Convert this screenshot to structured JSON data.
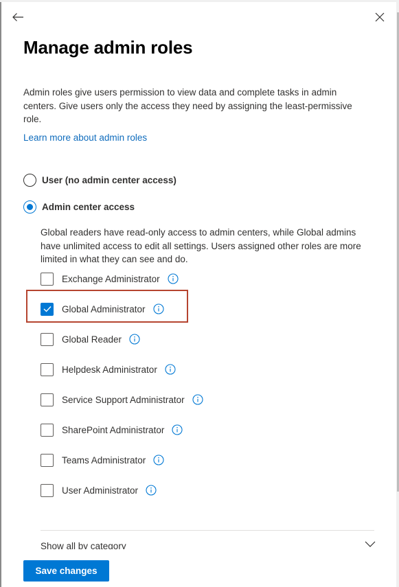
{
  "panel": {
    "title": "Manage admin roles",
    "description": "Admin roles give users permission to view data and complete tasks in admin centers. Give users only the access they need by assigning the least-permissive role.",
    "learn_more_link": "Learn more about admin roles",
    "icons": {
      "back": "arrow-left-icon",
      "close": "close-icon"
    }
  },
  "access_options": [
    {
      "label": "User (no admin center access)",
      "selected": false
    },
    {
      "label": "Admin center access",
      "selected": true
    }
  ],
  "admin_access_description": "Global readers have read-only access to admin centers, while Global admins have unlimited access to edit all settings. Users assigned other roles are more limited in what they can see and do.",
  "roles": [
    {
      "label": "Exchange Administrator",
      "checked": false
    },
    {
      "label": "Global Administrator",
      "checked": true,
      "highlighted": true
    },
    {
      "label": "Global Reader",
      "checked": false
    },
    {
      "label": "Helpdesk Administrator",
      "checked": false
    },
    {
      "label": "Service Support Administrator",
      "checked": false
    },
    {
      "label": "SharePoint Administrator",
      "checked": false
    },
    {
      "label": "Teams Administrator",
      "checked": false
    },
    {
      "label": "User Administrator",
      "checked": false
    }
  ],
  "show_all": {
    "label": "Show all by category",
    "expanded": false
  },
  "footer": {
    "save_label": "Save changes"
  },
  "colors": {
    "accent": "#0078d4",
    "link": "#0f6cbd",
    "highlight_border": "#b5442f",
    "text": "#323130"
  }
}
